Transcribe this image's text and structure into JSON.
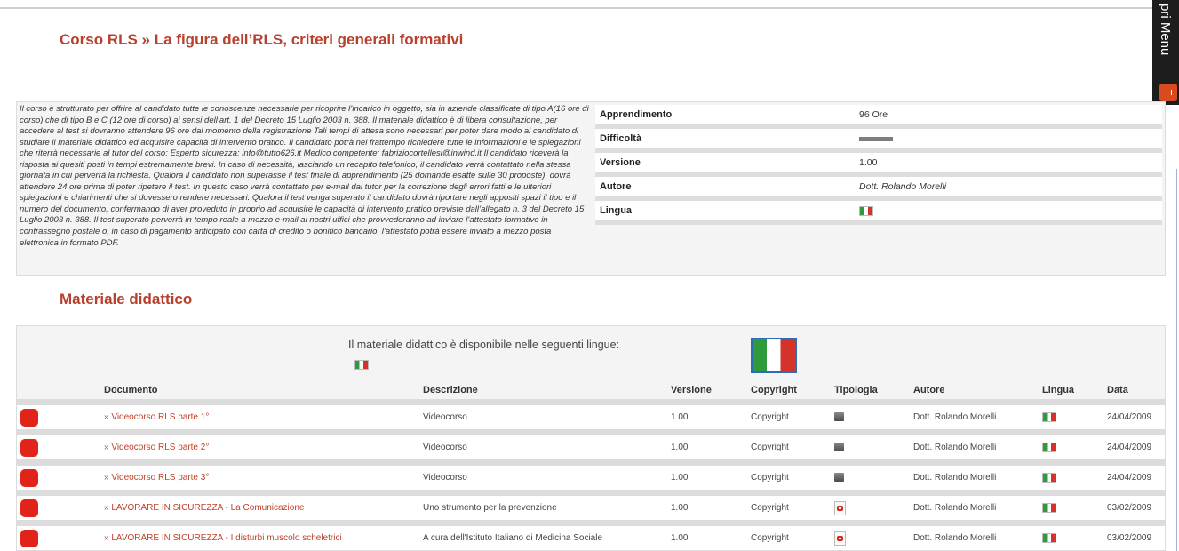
{
  "page": {
    "title": "Corso RLS » La figura dell’RLS, criteri generali formativi",
    "side_menu_label": "pri Menu"
  },
  "course": {
    "description": "Il corso è strutturato per offrire al candidato tutte le conoscenze necessarie per ricoprire l’incarico in oggetto, sia in aziende classificate di tipo A(16 ore di corso) che di tipo B e C (12 ore di corso) ai sensi dell’art. 1 del Decreto 15 Luglio 2003 n. 388. Il materiale didattico è di libera consultazione, per accedere al test si dovranno attendere 96 ore dal momento della registrazione Tali tempi di attesa sono necessari per poter dare modo al candidato di studiare il materiale didattico ed acquisire capacità di intervento pratico. Il candidato potrà nel frattempo richiedere tutte le informazioni e le spiegazioni che riterrà necessarie al tutor del corso: Esperto sicurezza: info@tutto626.it Medico competente: fabriziocortellesi@inwind.it Il candidato riceverà la risposta ai quesiti posti in tempi estremamente brevi. In caso di necessità, lasciando un recapito telefonico, il candidato verrà contattato nella stessa giornata in cui perverrà la richiesta. Qualora il candidato non superasse il test finale di apprendimento (25 domande esatte sulle 30 proposte), dovrà attendere 24 ore prima di poter ripetere il test. In questo caso verrà contattato per e-mail dai tutor per la correzione degli errori fatti e le ulteriori spiegazioni e chiarimenti che si dovessero rendere necessari. Qualora il test venga superato il candidato dovrà riportare negli appositi spazi il tipo e il numero del documento, confermando di aver proveduto in proprio ad acquisire le capacità di intervento pratico previste dall’allegato n. 3 del Decreto 15 Luglio 2003 n. 388. Il test superato perverrà in tempo reale a mezzo e-mail ai nostri uffici che provvederanno ad inviare l’attestato formativo in contrassegno postale o, in caso di pagamento anticipato con carta di credito o bonifico bancario, l’attestato potrà essere inviato a mezzo posta elettronica in formato PDF.",
    "info": {
      "apprendimento_label": "Apprendimento",
      "apprendimento_value": "96 Ore",
      "difficolta_label": "Difficoltà",
      "versione_label": "Versione",
      "versione_value": "1.00",
      "autore_label": "Autore",
      "autore_value": "Dott. Rolando Morelli",
      "lingua_label": "Lingua"
    }
  },
  "materials": {
    "section_title": "Materiale didattico",
    "languages_note": "Il materiale didattico è disponibile nelle seguenti lingue:",
    "columns": {
      "documento": "Documento",
      "descrizione": "Descrizione",
      "versione": "Versione",
      "copyright": "Copyright",
      "tipologia": "Tipologia",
      "autore": "Autore",
      "lingua": "Lingua",
      "data": "Data"
    },
    "rows": [
      {
        "documento": "» Videocorso RLS parte 1°",
        "descrizione": "Videocorso",
        "versione": "1.00",
        "copyright": "Copyright",
        "tipologia": "video-icon",
        "autore": "Dott. Rolando Morelli",
        "data": "24/04/2009"
      },
      {
        "documento": "» Videocorso RLS parte 2°",
        "descrizione": "Videocorso",
        "versione": "1.00",
        "copyright": "Copyright",
        "tipologia": "video-icon",
        "autore": "Dott. Rolando Morelli",
        "data": "24/04/2009"
      },
      {
        "documento": "» Videocorso RLS parte 3°",
        "descrizione": "Videocorso",
        "versione": "1.00",
        "copyright": "Copyright",
        "tipologia": "video-icon",
        "autore": "Dott. Rolando Morelli",
        "data": "24/04/2009"
      },
      {
        "documento": "» LAVORARE IN SICUREZZA - La Comunicazione",
        "descrizione": "Uno strumento per la prevenzione",
        "versione": "1.00",
        "copyright": "Copyright",
        "tipologia": "pdf-icon",
        "autore": "Dott. Rolando Morelli",
        "data": "03/02/2009"
      },
      {
        "documento": "» LAVORARE IN SICUREZZA - I disturbi muscolo scheletrici",
        "descrizione": "A cura dell'Istituto Italiano di Medicina Sociale",
        "versione": "1.00",
        "copyright": "Copyright",
        "tipologia": "pdf-icon",
        "autore": "Dott. Rolando Morelli",
        "data": "03/02/2009"
      }
    ]
  },
  "colors": {
    "title": "#b8412d",
    "link": "#c0412a",
    "status_square": "#e2231a",
    "menu_bg": "#1d1d1d",
    "menu_accent": "#d94a1e"
  }
}
